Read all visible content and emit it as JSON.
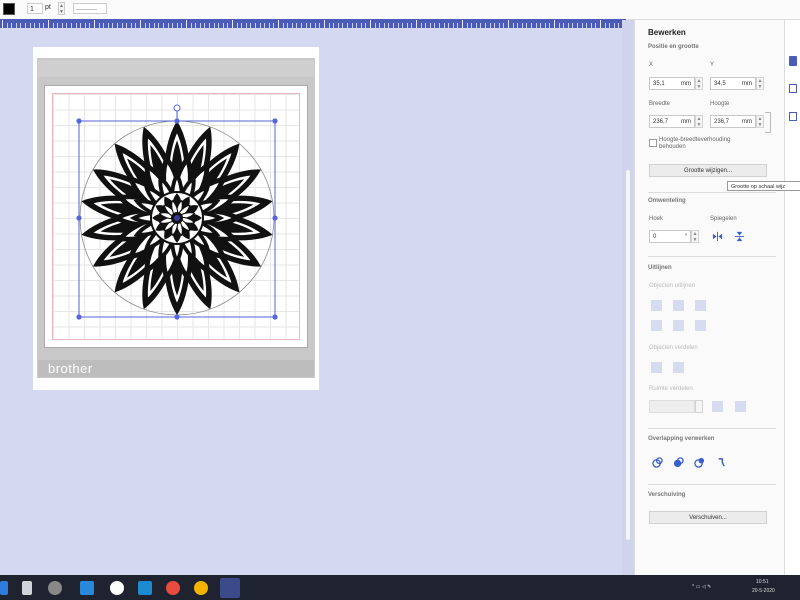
{
  "toolbar": {
    "stroke_width": "1",
    "stroke_unit": "pt",
    "line_style": "———",
    "fill_color": "#000000"
  },
  "canvas": {
    "brand": "brother",
    "accent_color": "#4a5cb8"
  },
  "panel": {
    "title": "Bewerken",
    "position_size": {
      "heading": "Positie en grootte",
      "x_label": "X",
      "x_value": "35,1",
      "y_label": "Y",
      "y_value": "34,5",
      "unit": "mm",
      "width_label": "Breedte",
      "width_value": "236,7",
      "height_label": "Hoogte",
      "height_value": "236,7",
      "keep_ratio_label": "Hoogte-breedteverhouding behouden",
      "resize_button": "Grootte wijzigen...",
      "resize_tooltip": "Grootte op schaal wijz"
    },
    "rotate": {
      "heading": "Omwenteling",
      "angle_label": "Hoek",
      "angle_value": "0",
      "angle_unit": "°",
      "mirror_label": "Spiegelen"
    },
    "align": {
      "heading": "Uitlijnen",
      "align_objects_label": "Objecten uitlijnen",
      "distribute_label": "Objecten verdelen",
      "space_label": "Ruimte verdelen"
    },
    "overlap": {
      "heading": "Overlapping verwerken"
    },
    "move": {
      "heading": "Verschuiving",
      "button": "Verschuiven..."
    }
  },
  "taskbar": {
    "time": "10:51",
    "date": "20-5-2020"
  }
}
